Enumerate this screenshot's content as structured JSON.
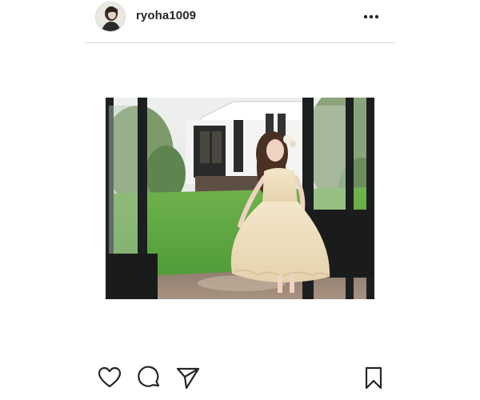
{
  "post": {
    "username": "ryoha1009"
  },
  "icons": {
    "more": "more-options-icon",
    "like": "heart-icon",
    "comment": "comment-icon",
    "share": "paper-plane-icon",
    "save": "bookmark-icon"
  },
  "colors": {
    "text": "#262626",
    "divider": "#dbdbdb",
    "background": "#ffffff"
  }
}
